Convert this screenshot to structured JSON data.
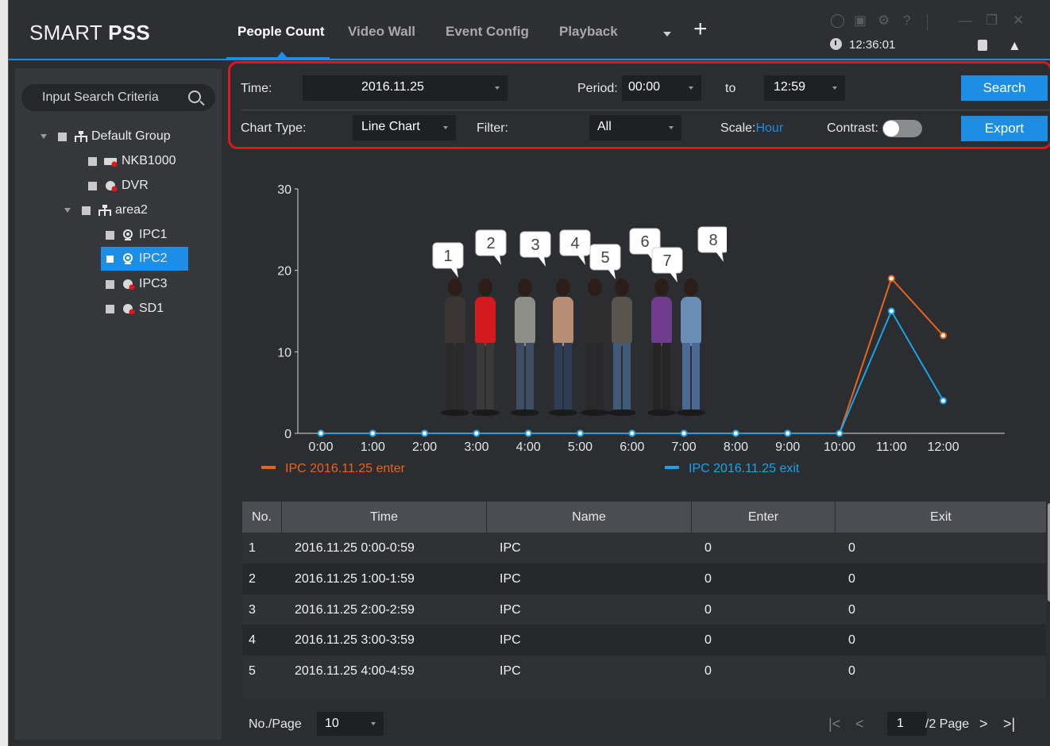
{
  "app": {
    "logo_light": "SMART ",
    "logo_bold": "PSS"
  },
  "tabs": [
    "People Count",
    "Video Wall",
    "Event Config",
    "Playback"
  ],
  "clock": "12:36:01",
  "sidebar": {
    "search_placeholder": "Input Search Criteria",
    "tree": [
      {
        "label": "Default Group",
        "icon": "group-icon"
      },
      {
        "label": "NKB1000",
        "icon": "keyboard-offline-icon"
      },
      {
        "label": "DVR",
        "icon": "device-offline-icon"
      },
      {
        "label": "area2",
        "icon": "group-icon"
      },
      {
        "label": "IPC1",
        "icon": "camera-icon"
      },
      {
        "label": "IPC2",
        "icon": "camera-icon",
        "selected": true
      },
      {
        "label": "IPC3",
        "icon": "device-offline-icon"
      },
      {
        "label": "SD1",
        "icon": "device-offline-icon"
      }
    ]
  },
  "filters": {
    "time_label": "Time:",
    "time_value": "2016.11.25",
    "period_label": "Period:",
    "period_from": "00:00",
    "to_label": "to",
    "period_to": "12:59",
    "search_label": "Search",
    "chart_type_label": "Chart Type:",
    "chart_type_value": "Line Chart",
    "filter_label": "Filter:",
    "filter_value": "All",
    "scale_label": "Scale:",
    "scale_value": "Hour",
    "contrast_label": "Contrast:",
    "export_label": "Export"
  },
  "colors": {
    "accent": "#1d8ee6",
    "enter": "#e8641b",
    "exit": "#1aa3e8",
    "highlight_border": "#e0161b"
  },
  "chart_data": {
    "type": "line",
    "x": [
      "0:00",
      "1:00",
      "2:00",
      "3:00",
      "4:00",
      "5:00",
      "6:00",
      "7:00",
      "8:00",
      "9:00",
      "10:00",
      "11:00",
      "12:00"
    ],
    "ylim": [
      0,
      30
    ],
    "yticks": [
      "0",
      "10",
      "20",
      "30"
    ],
    "series": [
      {
        "name": "IPC 2016.11.25 enter",
        "values": [
          0,
          0,
          0,
          0,
          0,
          0,
          0,
          0,
          0,
          0,
          0,
          19,
          12
        ]
      },
      {
        "name": "IPC 2016.11.25 exit",
        "values": [
          0,
          0,
          0,
          0,
          0,
          0,
          0,
          0,
          0,
          0,
          0,
          15,
          4
        ]
      }
    ]
  },
  "people_numbers": [
    "1",
    "2",
    "3",
    "4",
    "5",
    "6",
    "7",
    "8"
  ],
  "table": {
    "headers": [
      "No.",
      "Time",
      "Name",
      "Enter",
      "Exit"
    ],
    "rows": [
      [
        "1",
        "2016.11.25  0:00-0:59",
        "IPC",
        "0",
        "0"
      ],
      [
        "2",
        "2016.11.25  1:00-1:59",
        "IPC",
        "0",
        "0"
      ],
      [
        "3",
        "2016.11.25  2:00-2:59",
        "IPC",
        "0",
        "0"
      ],
      [
        "4",
        "2016.11.25  3:00-3:59",
        "IPC",
        "0",
        "0"
      ],
      [
        "5",
        "2016.11.25  4:00-4:59",
        "IPC",
        "0",
        "0"
      ]
    ]
  },
  "pager": {
    "per_page_label": "No./Page",
    "per_page_value": "10",
    "page_value": "1",
    "page_total": "/2 Page"
  }
}
